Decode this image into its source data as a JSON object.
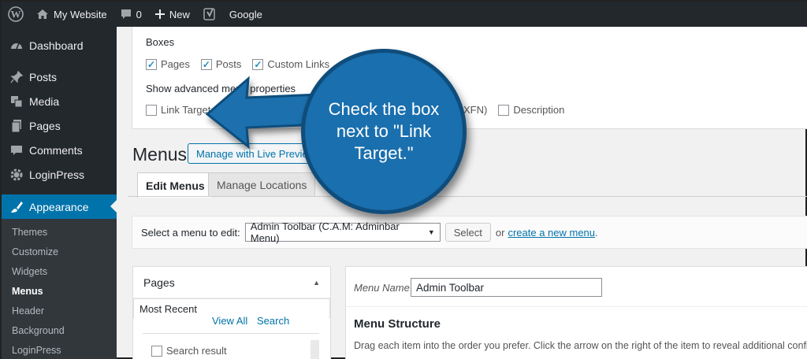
{
  "admin_bar": {
    "site_name": "My Website",
    "comments_count": "0",
    "new_label": "New",
    "google_label": "Google"
  },
  "sidebar": {
    "items": [
      {
        "label": "Dashboard",
        "icon": "dashboard-icon"
      },
      {
        "label": "Posts",
        "icon": "pin-icon"
      },
      {
        "label": "Media",
        "icon": "media-icon"
      },
      {
        "label": "Pages",
        "icon": "pages-icon"
      },
      {
        "label": "Comments",
        "icon": "comment-icon"
      },
      {
        "label": "LoginPress",
        "icon": "gear-icon"
      },
      {
        "label": "Appearance",
        "icon": "brush-icon"
      }
    ],
    "submenu": [
      "Themes",
      "Customize",
      "Widgets",
      "Menus",
      "Header",
      "Background",
      "LoginPress"
    ]
  },
  "screen_options": {
    "boxes_title": "Boxes",
    "boxes": [
      {
        "label": "Pages",
        "checked": true
      },
      {
        "label": "Posts",
        "checked": true
      },
      {
        "label": "Custom Links",
        "checked": true
      }
    ],
    "advanced_title": "Show advanced menu properties",
    "advanced": [
      {
        "label": "Link Target",
        "checked": false
      },
      {
        "label": "XFN)",
        "checked": false
      },
      {
        "label": "Description",
        "checked": false
      }
    ]
  },
  "main": {
    "page_title": "Menus",
    "live_preview_label": "Manage with Live Preview",
    "tabs": [
      {
        "label": "Edit Menus",
        "active": true
      },
      {
        "label": "Manage Locations",
        "active": false
      }
    ],
    "select_label": "Select a menu to edit:",
    "selected_menu": "Admin Toolbar (C.A.M: Adminbar Menu)",
    "select_button": "Select",
    "or_text": "or",
    "create_link": "create a new menu",
    "create_suffix": "."
  },
  "pages_panel": {
    "title": "Pages",
    "tabs": [
      "Most Recent",
      "View All",
      "Search"
    ],
    "search_result_label": "Search result"
  },
  "menu_panel": {
    "menu_name_label": "Menu Name",
    "menu_name_value": "Admin Toolbar",
    "structure_title": "Menu Structure",
    "structure_desc": "Drag each item into the order you prefer. Click the arrow on the right of the item to reveal additional configurati"
  },
  "callout": {
    "text": "Check the box next to \"Link Target.\""
  },
  "colors": {
    "admin_dark": "#23282d",
    "accent": "#0073aa",
    "callout_blue": "#1a6fae"
  }
}
